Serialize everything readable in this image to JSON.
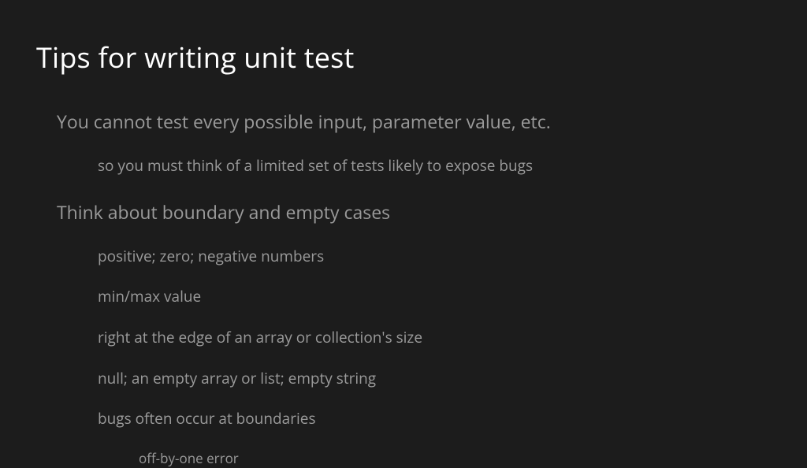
{
  "slide": {
    "title": "Tips for writing unit test",
    "bullets": [
      {
        "text": "You cannot test every possible input, parameter value, etc.",
        "sub": [
          "so you must think of a limited set of tests likely to expose bugs"
        ]
      },
      {
        "text": "Think about boundary and empty cases",
        "sub": [
          "positive; zero; negative numbers",
          "min/max value",
          "right at the edge of an array or collection's size",
          "null; an empty array or list; empty string",
          "bugs often occur at boundaries"
        ],
        "subsub": [
          "off-by-one error"
        ]
      }
    ]
  }
}
